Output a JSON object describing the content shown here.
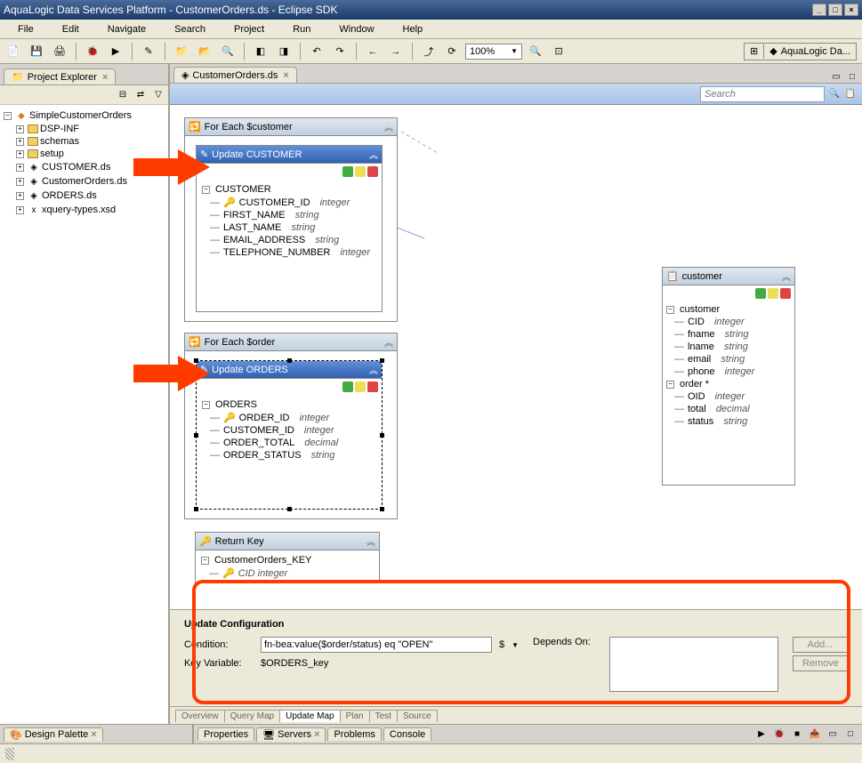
{
  "window": {
    "title": "AquaLogic Data Services Platform - CustomerOrders.ds - Eclipse SDK"
  },
  "menu": {
    "file": "File",
    "edit": "Edit",
    "navigate": "Navigate",
    "search": "Search",
    "project": "Project",
    "run": "Run",
    "window": "Window",
    "help": "Help"
  },
  "toolbar": {
    "zoom": "100%"
  },
  "perspective": {
    "label": "AquaLogic Da..."
  },
  "project_explorer": {
    "title": "Project Explorer",
    "root": "SimpleCustomerOrders",
    "items": [
      "DSP-INF",
      "schemas",
      "setup",
      "CUSTOMER.ds",
      "CustomerOrders.ds",
      "ORDERS.ds",
      "xquery-types.xsd"
    ]
  },
  "editor": {
    "tab": "CustomerOrders.ds",
    "search_placeholder": "Search"
  },
  "blocks": {
    "foreach_customer": "For Each $customer",
    "update_customer": "Update CUSTOMER",
    "customer_root": "CUSTOMER",
    "customer_fields": [
      {
        "name": "CUSTOMER_ID",
        "type": "integer",
        "key": true
      },
      {
        "name": "FIRST_NAME",
        "type": "string"
      },
      {
        "name": "LAST_NAME",
        "type": "string"
      },
      {
        "name": "EMAIL_ADDRESS",
        "type": "string"
      },
      {
        "name": "TELEPHONE_NUMBER",
        "type": "integer"
      }
    ],
    "foreach_order": "For Each $order",
    "update_orders": "Update ORDERS",
    "orders_root": "ORDERS",
    "orders_fields": [
      {
        "name": "ORDER_ID",
        "type": "integer",
        "key": true
      },
      {
        "name": "CUSTOMER_ID",
        "type": "integer"
      },
      {
        "name": "ORDER_TOTAL",
        "type": "decimal"
      },
      {
        "name": "ORDER_STATUS",
        "type": "string"
      }
    ],
    "return_key": "Return Key",
    "return_body": "CustomerOrders_KEY",
    "return_sub": "CID  integer"
  },
  "source_block": {
    "title": "customer",
    "root": "customer",
    "customer_fields": [
      {
        "name": "CID",
        "type": "integer"
      },
      {
        "name": "fname",
        "type": "string"
      },
      {
        "name": "lname",
        "type": "string"
      },
      {
        "name": "email",
        "type": "string"
      },
      {
        "name": "phone",
        "type": "integer"
      }
    ],
    "order_root": "order *",
    "order_fields": [
      {
        "name": "OID",
        "type": "integer"
      },
      {
        "name": "total",
        "type": "decimal"
      },
      {
        "name": "status",
        "type": "string"
      }
    ]
  },
  "config": {
    "heading": "Update Configuration",
    "condition_label": "Condition:",
    "condition_value": "fn-bea:value($order/status) eq \"OPEN\"",
    "key_var_label": "Key Variable:",
    "key_var_value": "$ORDERS_key",
    "depends_label": "Depends On:",
    "add_btn": "Add...",
    "remove_btn": "Remove"
  },
  "editor_bottom_tabs": {
    "overview": "Overview",
    "querymap": "Query Map",
    "updatemap": "Update Map",
    "plan": "Plan",
    "test": "Test",
    "source": "Source"
  },
  "bottom": {
    "design_palette": "Design Palette",
    "properties": "Properties",
    "servers": "Servers",
    "problems": "Problems",
    "console": "Console"
  }
}
